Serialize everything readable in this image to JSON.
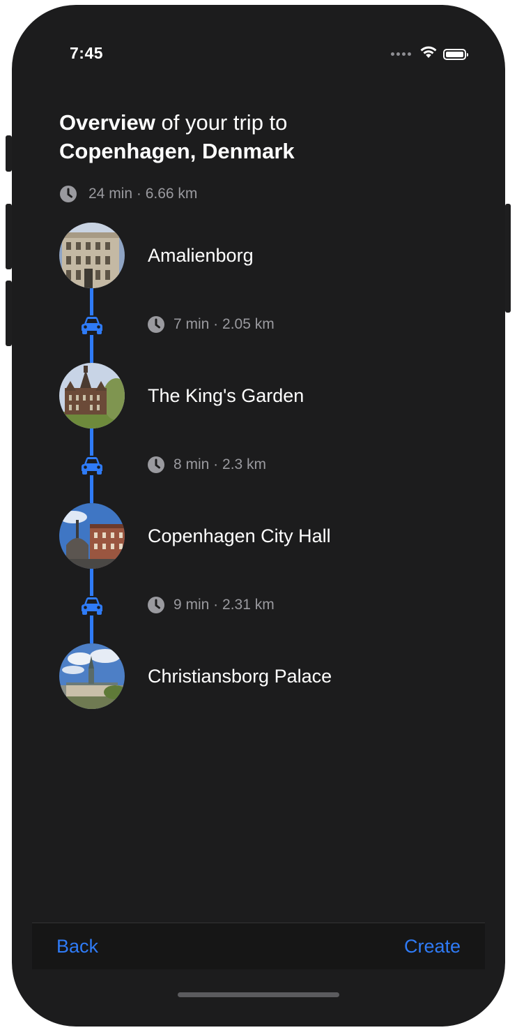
{
  "status_bar": {
    "time": "7:45",
    "icons": [
      "cellular-signal-icon",
      "wifi-icon",
      "battery-icon"
    ]
  },
  "header": {
    "title_bold": "Overview",
    "title_rest": " of your trip to",
    "destination": "Copenhagen, Denmark"
  },
  "summary": {
    "icon": "clock-icon",
    "text": "24 min · 6.66 km"
  },
  "stops": [
    {
      "name": "Amalienborg"
    },
    {
      "name": "The King's Garden"
    },
    {
      "name": "Copenhagen City Hall"
    },
    {
      "name": "Christiansborg Palace"
    }
  ],
  "legs": [
    {
      "mode_icon": "car-icon",
      "text": "7 min · 2.05 km"
    },
    {
      "mode_icon": "car-icon",
      "text": "8 min · 2.3 km"
    },
    {
      "mode_icon": "car-icon",
      "text": "9 min · 2.31 km"
    }
  ],
  "bottom_bar": {
    "back_label": "Back",
    "create_label": "Create"
  },
  "colors": {
    "background": "#1c1c1d",
    "accent": "#2f7bf6",
    "secondary_text": "#9a9a9f"
  }
}
